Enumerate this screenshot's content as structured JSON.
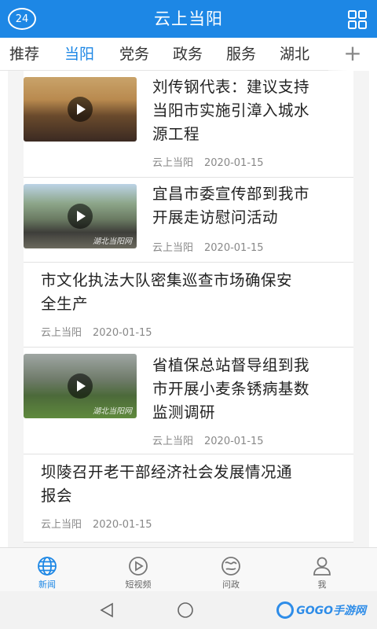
{
  "header": {
    "badge": "24",
    "title": "云上当阳",
    "menu_icon": "grid-icon",
    "bg_color": "#1d87e5"
  },
  "tabs": {
    "items": [
      "推荐",
      "当阳",
      "党务",
      "政务",
      "服务",
      "湖北"
    ],
    "active_index": 1,
    "add_label": "+"
  },
  "feed": {
    "articles": [
      {
        "title_lines": [
          "刘传钢代表：建议支持",
          "当阳市实施引漳入城水",
          "源工程"
        ],
        "source": "云上当阳",
        "date": "2020-01-15",
        "has_video": true
      },
      {
        "title_lines": [
          "宜昌市委宣传部到我市",
          "开展走访慰问活动"
        ],
        "source": "云上当阳",
        "date": "2020-01-15",
        "has_video": true,
        "watermark": "湖北当阳网"
      },
      {
        "title_lines": [
          "市文化执法大队密集巡查市场确保安",
          "全生产"
        ],
        "source": "云上当阳",
        "date": "2020-01-15"
      },
      {
        "title_lines": [
          "省植保总站督导组到我",
          "市开展小麦条锈病基数",
          "监测调研"
        ],
        "source": "云上当阳",
        "date": "2020-01-15",
        "has_video": true,
        "watermark": "湖北当阳网"
      },
      {
        "title_lines": [
          "坝陵召开老干部经济社会发展情况通",
          "报会"
        ],
        "source": "云上当阳",
        "date": "2020-01-15"
      }
    ]
  },
  "tabbar": {
    "items": [
      {
        "label": "新闻",
        "icon": "globe-icon"
      },
      {
        "label": "短视频",
        "icon": "play-circle-icon"
      },
      {
        "label": "问政",
        "icon": "question-globe-icon"
      },
      {
        "label": "我",
        "icon": "user-icon"
      }
    ],
    "active_index": 0
  },
  "system_nav": {
    "back_icon": "back-triangle-icon",
    "home_icon": "home-circle-icon",
    "watermark": "GOGO手游网"
  }
}
